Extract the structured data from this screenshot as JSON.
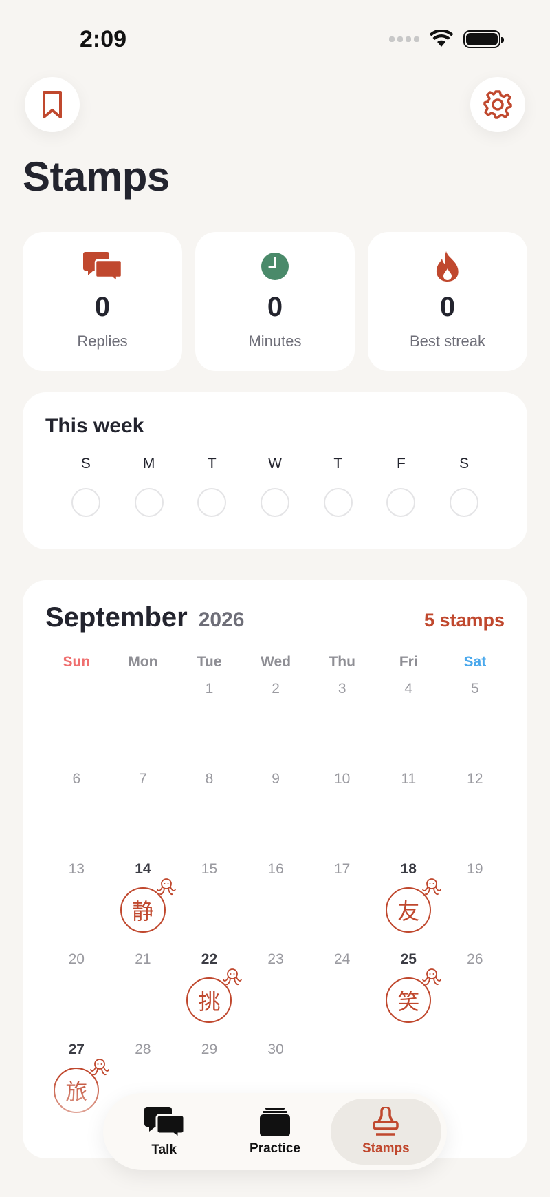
{
  "status_bar": {
    "time": "2:09"
  },
  "header": {
    "title": "Stamps",
    "bookmark_icon": "bookmark-icon",
    "settings_icon": "gear-icon"
  },
  "stats": [
    {
      "value": "0",
      "label": "Replies",
      "icon": "chat-bubbles-icon"
    },
    {
      "value": "0",
      "label": "Minutes",
      "icon": "clock-icon"
    },
    {
      "value": "0",
      "label": "Best streak",
      "icon": "flame-icon"
    }
  ],
  "week": {
    "title": "This week",
    "days": [
      "S",
      "M",
      "T",
      "W",
      "T",
      "F",
      "S"
    ]
  },
  "calendar": {
    "month": "September",
    "year": "2026",
    "stamp_count": "5 stamps",
    "weekdays": [
      "Sun",
      "Mon",
      "Tue",
      "Wed",
      "Thu",
      "Fri",
      "Sat"
    ],
    "stamps": [
      {
        "day": 14,
        "kanji": "静"
      },
      {
        "day": 18,
        "kanji": "友"
      },
      {
        "day": 22,
        "kanji": "挑"
      },
      {
        "day": 25,
        "kanji": "笑"
      },
      {
        "day": 27,
        "kanji": "旅"
      }
    ]
  },
  "tabs": [
    {
      "label": "Talk",
      "icon": "chat-bubbles-icon"
    },
    {
      "label": "Practice",
      "icon": "cards-icon"
    },
    {
      "label": "Stamps",
      "icon": "stamp-icon",
      "active": true
    }
  ],
  "colors": {
    "accent": "#c0482e",
    "green": "#4a8a6a",
    "sunday": "#ef6f6f",
    "saturday": "#4aa8ec"
  }
}
